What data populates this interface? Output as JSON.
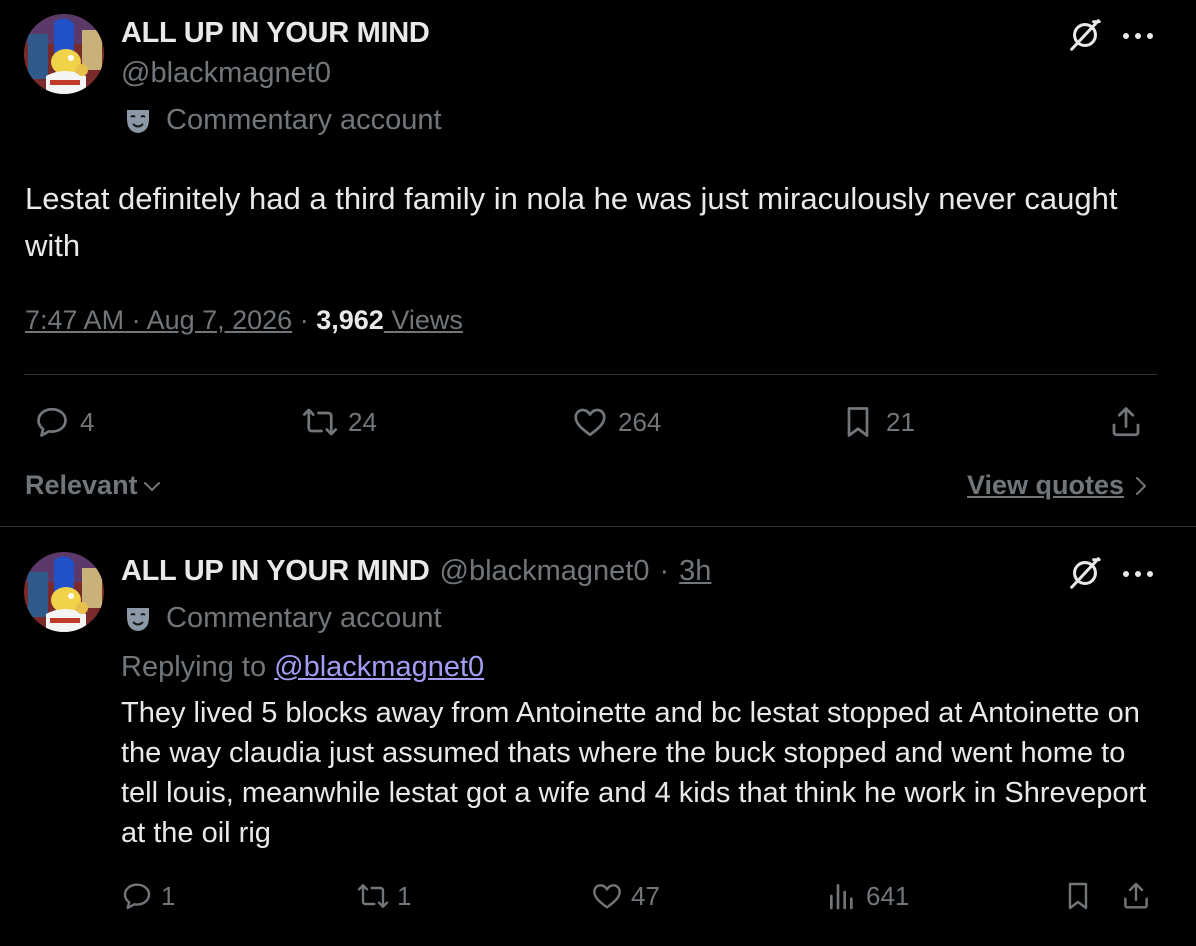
{
  "main_post": {
    "display_name": "ALL UP IN YOUR MIND",
    "handle": "@blackmagnet0",
    "badge_label": "Commentary account",
    "text": "Lestat definitely had a third family in nola he was just miraculously never caught with",
    "timestamp": "7:47 AM · Aug 7, 2026",
    "separator": "·",
    "views_count": "3,962",
    "views_label": " Views",
    "actions": {
      "replies": "4",
      "reposts": "24",
      "likes": "264",
      "bookmarks": "21"
    },
    "sort_label": "Relevant",
    "view_quotes_label": "View quotes"
  },
  "reply_post": {
    "display_name": "ALL UP IN YOUR MIND",
    "handle": "@blackmagnet0",
    "dot": "·",
    "time": "3h",
    "badge_label": "Commentary account",
    "replying_prefix": "Replying to ",
    "replying_handle": "@blackmagnet0",
    "text": "They lived 5 blocks away from Antoinette and bc lestat stopped at Antoinette on the way claudia just assumed thats where the buck stopped and went home to tell louis, meanwhile lestat got a wife and 4 kids that think he work in Shreveport at the oil rig",
    "actions": {
      "replies": "1",
      "reposts": "1",
      "likes": "47",
      "views": "641"
    }
  },
  "icons": {
    "grok": "grok-icon",
    "more": "more-icon",
    "mask": "theater-mask-icon",
    "reply": "reply-icon",
    "repost": "repost-icon",
    "like": "heart-icon",
    "bookmark": "bookmark-icon",
    "share": "share-icon",
    "views": "views-icon",
    "chevron_down": "chevron-down-icon",
    "chevron_right": "chevron-right-icon"
  },
  "colors": {
    "background": "#000000",
    "text": "#e7e9ea",
    "muted": "#71767b",
    "divider": "#2f3336",
    "mention": "#a39cf4"
  }
}
